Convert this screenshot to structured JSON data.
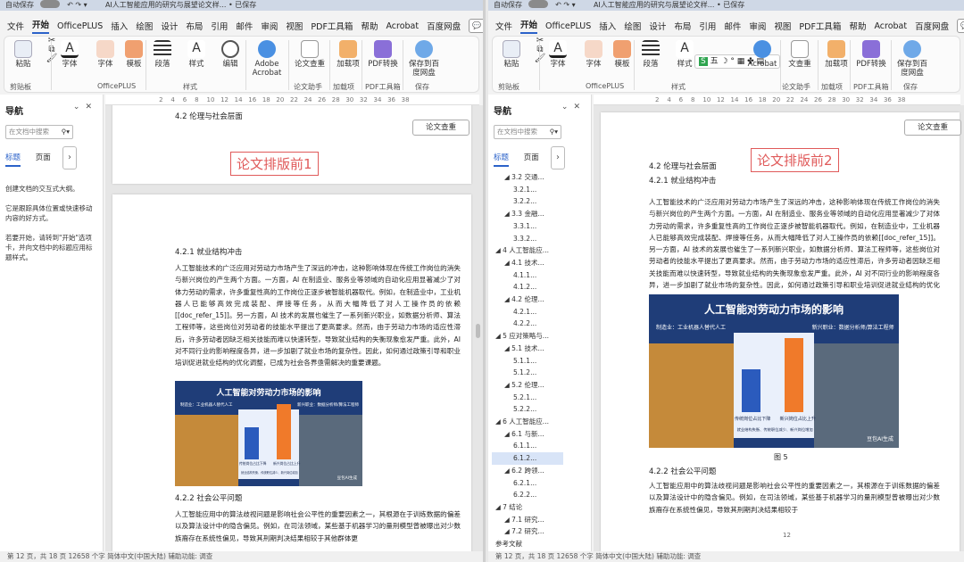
{
  "left": {
    "title": "AI人工智能应用的研究与展望论文样... • 已保存",
    "autosave": "自动保存",
    "tabs": [
      "文件",
      "开始",
      "OfficePLUS",
      "插入",
      "绘图",
      "设计",
      "布局",
      "引用",
      "邮件",
      "审阅",
      "视图",
      "PDF工具箱",
      "帮助",
      "Acrobat",
      "百度网盘"
    ],
    "ribbon": {
      "paste": "粘贴",
      "font": "字体",
      "template": "模板",
      "paragraph": "段落",
      "style": "样式",
      "edit": "编辑",
      "adobe": "Adobe Acrobat",
      "check": "论文查重",
      "addin": "加载项",
      "pdfconv": "PDF转换",
      "baidusave": "保存到百度网盘",
      "groups": [
        "剪贴板",
        "OfficePLUS",
        "样式",
        "论文助手",
        "加载项",
        "PDF工具箱",
        "保存"
      ]
    },
    "nav": {
      "title": "导航",
      "search": "在文档中搜索",
      "tab_headings": "标题",
      "tab_pages": "页面",
      "text1": "创建文档的交互式大纲。",
      "text2": "它是跟踪具体位置或快速移动内容的好方式。",
      "text3": "若要开始，请转到\"开始\"选项卡，并向文档中的标题应用标题样式。"
    },
    "doc": {
      "prev_heading": "4.2 伦理与社会层面",
      "stamp": "论文排版前1",
      "check_btn": "论文查重",
      "h421": "4.2.1 就业结构冲击",
      "p1": "人工智能技术的广泛应用对劳动力市场产生了深远的冲击，这种影响体现在传统工作岗位的消失与新兴岗位的产生两个方面。一方面，AI 在制造业、服务业等领域的自动化应用显著减少了对体力劳动的需求，许多重复性高的工作岗位正逐步被智能机器取代。例如，在制造业中，工业机器人已能够高效完成装配、焊接等任务，从而大幅降低了对人工操作员的依赖[[doc_refer_15]]。另一方面，AI 技术的发展也催生了一系列新兴职业，如数据分析师、算法工程师等，这些岗位对劳动者的技能水平提出了更高要求。然而，由于劳动力市场的适应性滞后，许多劳动者因缺乏相关技能而难以快速转型，导致就业结构的失衡现象愈发严重。此外，AI 对不同行业的影响程度各异，进一步加剧了就业市场的复杂性。因此，如何通过政策引导和职业培训促进就业结构的优化调整，已成为社会各界亟需解决的重要课题。",
      "h422": "4.2.2 社会公平问题",
      "p2": "人工智能应用中的算法歧视问题是影响社会公平性的重要因素之一，其根源在于训练数据的偏差以及算法设计中的隐含偏见。例如，在司法领域，某些基于机器学习的量刑模型曾被曝出对少数族裔存在系统性偏见，导致其刑期判决结果相较于其他群体更"
    },
    "status": "第 12 页，共 18 页    12658 个字    简体中文(中国大陆)    辅助功能: 调查"
  },
  "right": {
    "title": "AI人工智能应用的研究与展望论文样... • 已保存",
    "autosave": "自动保存",
    "tabs": [
      "文件",
      "开始",
      "OfficePLUS",
      "插入",
      "绘图",
      "设计",
      "布局",
      "引用",
      "邮件",
      "审阅",
      "视图",
      "PDF工具箱",
      "帮助",
      "Acrobat",
      "百度网盘"
    ],
    "ribbon": {
      "paste": "粘贴",
      "font": "字体",
      "template": "模板",
      "paragraph": "段落",
      "style": "样式",
      "adobe": "Acrobat",
      "check": "文查重",
      "addin": "加载项",
      "pdfconv": "PDF转换",
      "baidusave": "保存到百度网盘",
      "float_toolbar": "五",
      "groups": [
        "剪贴板",
        "OfficePLUS",
        "样式",
        "论文助手",
        "加载项",
        "PDF工具箱",
        "保存"
      ]
    },
    "nav": {
      "title": "导航",
      "search": "在文档中搜索",
      "tab_headings": "标题",
      "tab_pages": "页面",
      "tree": [
        "3.2 交通...",
        "3.2.1...",
        "3.2.2...",
        "3.3 金融...",
        "3.3.1...",
        "3.3.2...",
        "4 人工智能应...",
        "4.1 技术...",
        "4.1.1...",
        "4.1.2...",
        "4.2 伦理...",
        "4.2.1...",
        "4.2.2...",
        "5 应对策略与...",
        "5.1 技术...",
        "5.1.1...",
        "5.1.2...",
        "5.2 伦理...",
        "5.2.1...",
        "5.2.2...",
        "6 人工智能应...",
        "6.1 与新...",
        "6.1.1...",
        "6.1.2...",
        "6.2 跨领...",
        "6.2.1...",
        "6.2.2...",
        "7 结论",
        "7.1 研究...",
        "7.2 研究...",
        "参考文献"
      ]
    },
    "doc": {
      "stamp": "论文排版前2",
      "check_btn": "论文查重",
      "h42": "4.2 伦理与社会层面",
      "h421": "4.2.1 就业结构冲击",
      "p1": "人工智能技术的广泛应用对劳动力市场产生了深远的冲击，这种影响体现在传统工作岗位的消失与新兴岗位的产生两个方面。一方面，AI 在制造业、服务业等领域的自动化应用显著减少了对体力劳动的需求，许多重复性高的工作岗位正逐步被智能机器取代。例如，在制造业中，工业机器人已能够高效完成装配、焊接等任务，从而大幅降低了对人工操作员的依赖[[doc_refer_15]]。另一方面，AI 技术的发展也催生了一系列新兴职业，如数据分析师、算法工程师等，这些岗位对劳动者的技能水平提出了更高要求。然而，由于劳动力市场的适应性滞后，许多劳动者因缺乏相关技能而难以快速转型，导致就业结构的失衡现象愈发严重。此外，AI 对不同行业的影响程度各异，进一步加剧了就业市场的复杂性。因此，如何通过政策引导和职业培训促进就业结构的优化调整，已成为社会各界亟需解决的重要课题。",
      "fig_caption": "图 5",
      "h422": "4.2.2 社会公平问题",
      "p2": "人工智能应用中的算法歧视问题是影响社会公平性的重要因素之一，其根源在于训练数据的偏差以及算法设计中的隐含偏见。例如，在司法领域，某些基于机器学习的量刑模型曾被曝出对少数族裔存在系统性偏见，导致其刑期判决结果相较于",
      "page_num": "12"
    },
    "status": "第 12 页，共 18 页    12658 个字    简体中文(中国大陆)    辅助功能: 调查"
  },
  "figure": {
    "title": "人工智能对劳动力市场的影响",
    "left_label": "制造业：工业机器人替代人工",
    "right_label": "新兴职业：数据分析师/算法工程师",
    "bar1_label": "传统岗位占比下降",
    "bar2_label": "新兴岗位占比上升",
    "caption": "就业结构失衡、传统职位减少、新兴岗位增加",
    "watermark": "豆包AI生成"
  }
}
